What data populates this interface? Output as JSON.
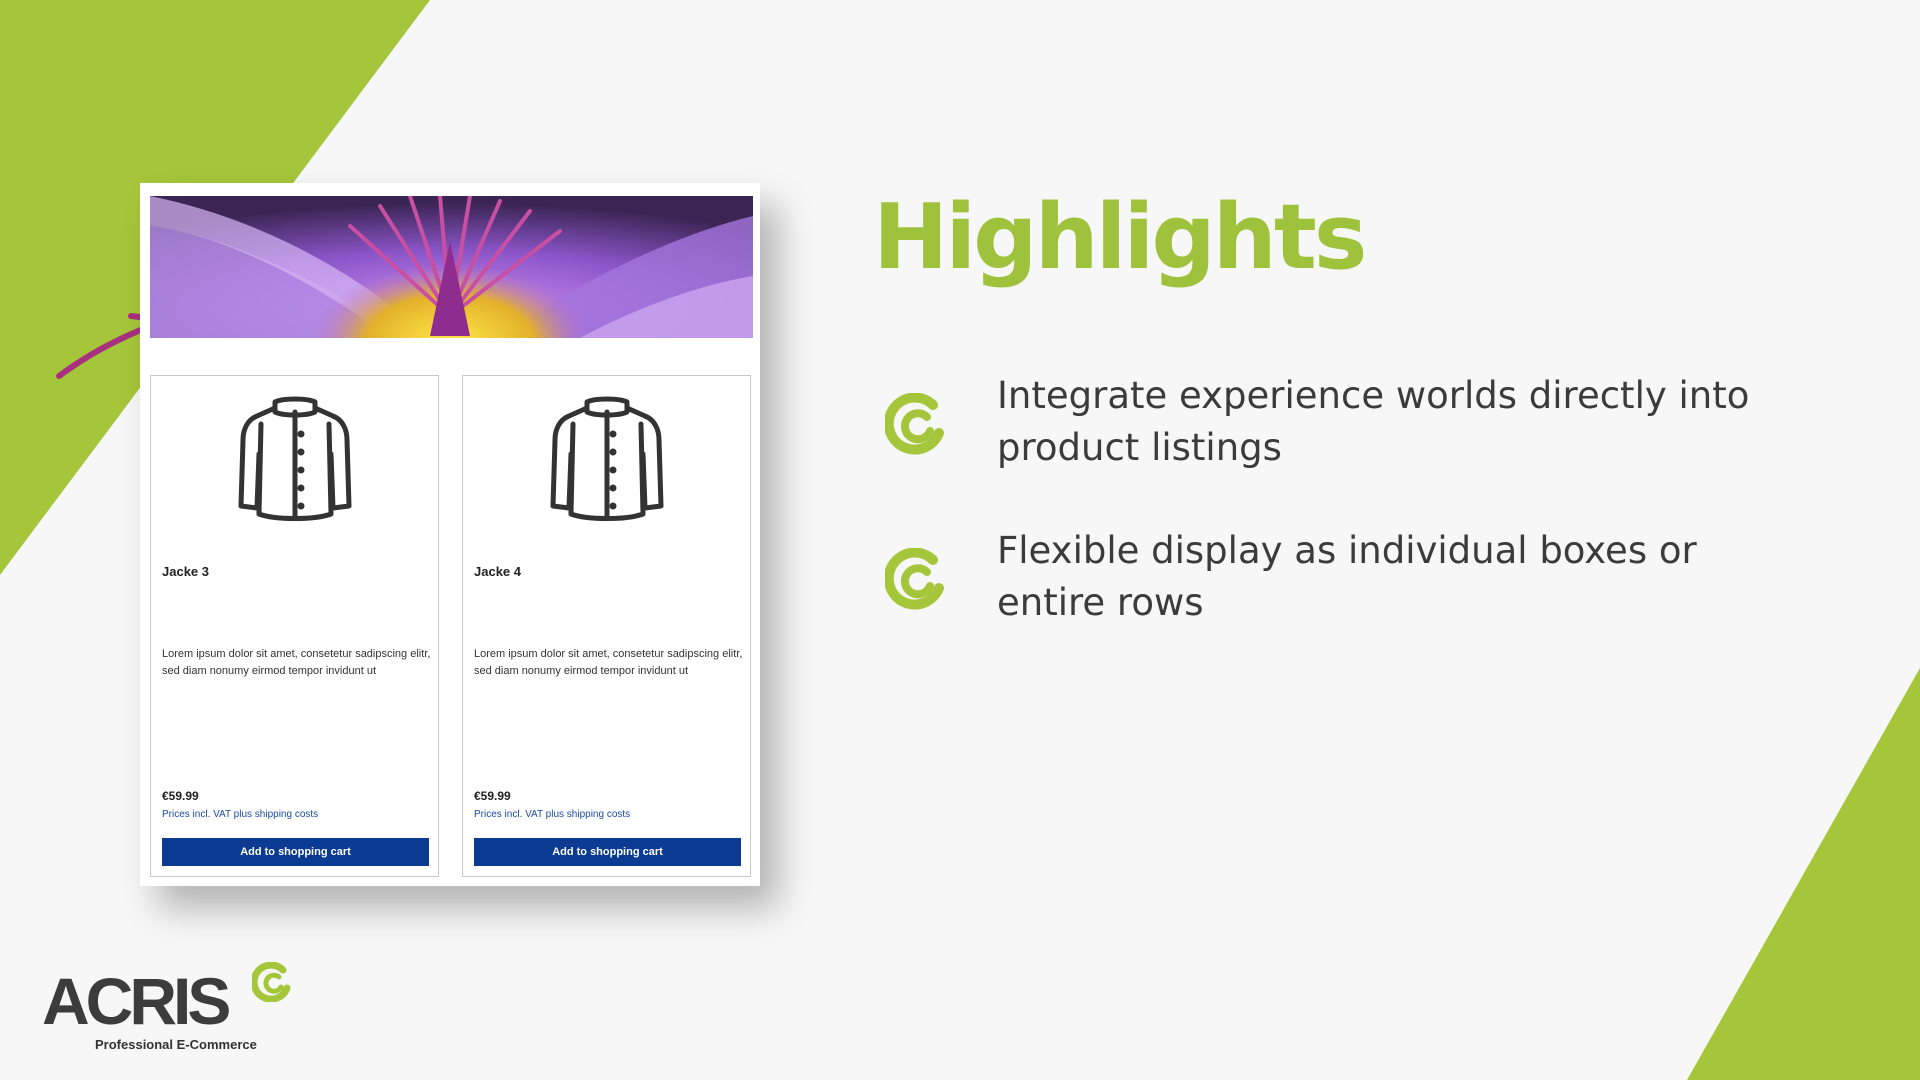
{
  "slide": {
    "heading": "Highlights",
    "bullets": [
      {
        "icon": "acris-c-icon",
        "text": "Integrate experience worlds directly into product listings"
      },
      {
        "icon": "acris-c-icon",
        "text": "Flexible display as individual boxes or entire rows"
      }
    ],
    "accent_color": "#9fc23c"
  },
  "screenshot": {
    "banner_image": "purple-water-lily-photo",
    "products": [
      {
        "name": "Jacke 3",
        "description": "Lorem ipsum dolor sit amet, consetetur sadipscing elitr, sed diam nonumy eirmod tempor invidunt ut",
        "price": "€59.99",
        "vat_note": "Prices incl. VAT plus shipping costs",
        "button": "Add to shopping cart"
      },
      {
        "name": "Jacke 4",
        "description": "Lorem ipsum dolor sit amet, consetetur sadipscing elitr, sed diam nonumy eirmod tempor invidunt ut",
        "price": "€59.99",
        "vat_note": "Prices incl. VAT plus shipping costs",
        "button": "Add to shopping cart"
      }
    ],
    "button_color": "#0b3a93"
  },
  "logo": {
    "wordmark": "ACRIS",
    "tagline": "Professional E-Commerce"
  }
}
